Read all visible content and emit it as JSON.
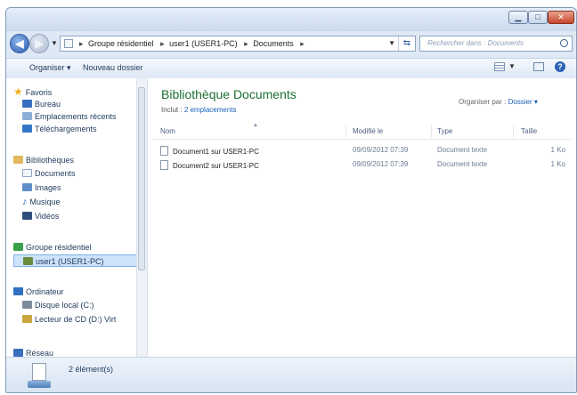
{
  "navbar": {
    "breadcrumbs": [
      "Groupe résidentiel",
      "user1 (USER1-PC)",
      "Documents"
    ],
    "search_placeholder": "Rechercher dans : Documents"
  },
  "toolbar": {
    "organize_label": "Organiser ▾",
    "new_folder_label": "Nouveau dossier"
  },
  "sidebar": {
    "favorites": {
      "heading": "Favoris",
      "items": [
        "Bureau",
        "Emplacements récents",
        "Téléchargements"
      ]
    },
    "libraries": {
      "heading": "Bibliothèques",
      "items": [
        "Documents",
        "Images",
        "Musique",
        "Vidéos"
      ]
    },
    "homegroup": {
      "heading": "Groupe résidentiel",
      "items": [
        "user1 (USER1-PC)"
      ]
    },
    "computer": {
      "heading": "Ordinateur",
      "items": [
        "Disque local (C:)",
        "Lecteur de CD (D:) Virt"
      ]
    },
    "network": {
      "heading": "Réseau"
    }
  },
  "content": {
    "title": "Bibliothèque Documents",
    "includes_label": "Inclut :",
    "includes_link": "2 emplacements",
    "arrange_label": "Organiser par :",
    "arrange_value": "Dossier ▾",
    "columns": [
      "Nom",
      "Modifié le",
      "Type",
      "Taille"
    ],
    "files": [
      {
        "name": "Document1 sur USER1-PC",
        "modified": "09/09/2012 07:39",
        "type": "Document texte",
        "size": "1 Ko"
      },
      {
        "name": "Document2 sur USER1-PC",
        "modified": "09/09/2012 07:39",
        "type": "Document texte",
        "size": "1 Ko"
      }
    ]
  },
  "status": {
    "count_text": "2 élément(s)"
  }
}
